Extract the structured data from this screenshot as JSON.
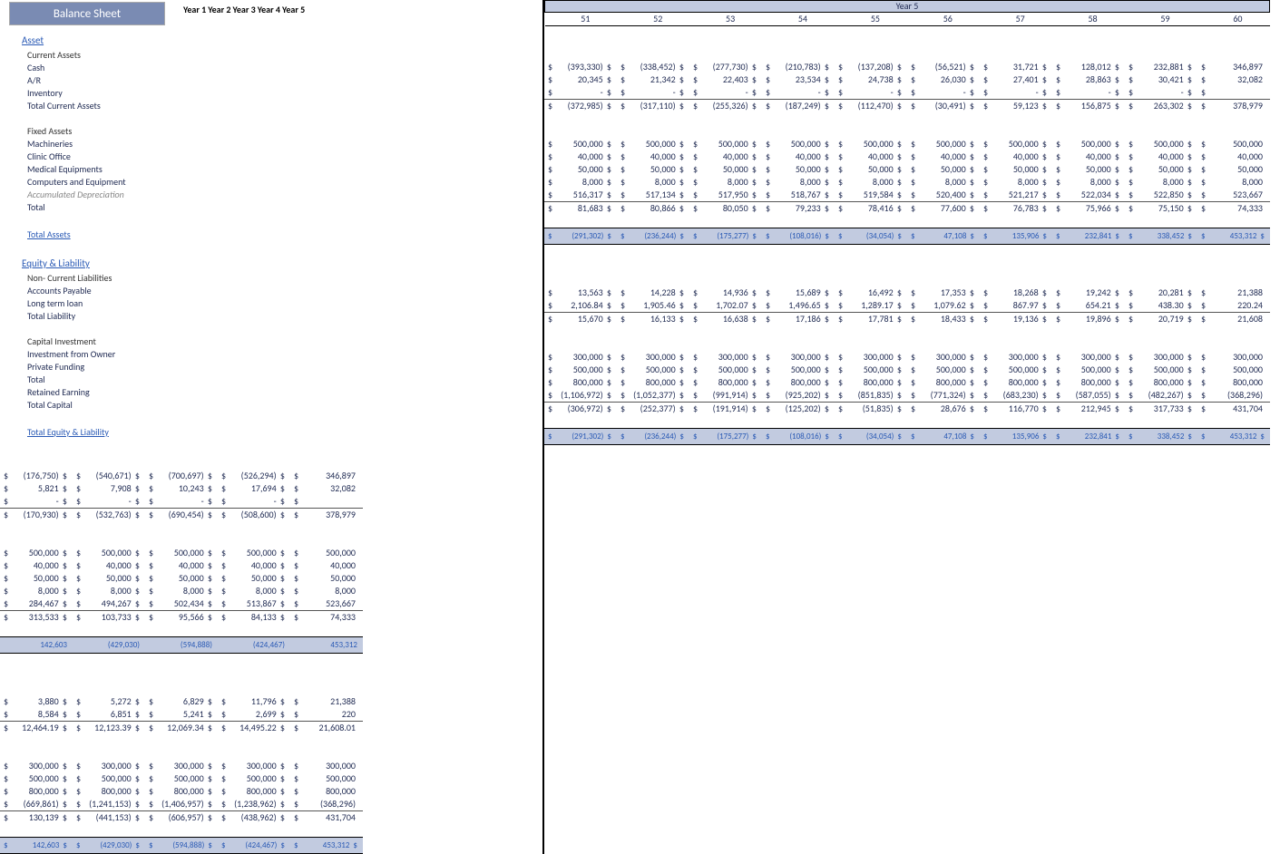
{
  "title": "Balance Sheet",
  "left_years": [
    "Year 1",
    "Year 2",
    "Year 3",
    "Year 4",
    "Year 5"
  ],
  "right_group": "Year 5",
  "right_cols": [
    "51",
    "52",
    "53",
    "54",
    "55",
    "56",
    "57",
    "58",
    "59",
    "60"
  ],
  "sections": [
    {
      "type": "hdr",
      "label": "Asset"
    },
    {
      "type": "sub",
      "label": "Current Assets"
    },
    {
      "label": "Cash",
      "dollar": true,
      "L": [
        "(176,750)",
        "(540,671)",
        "(700,697)",
        "(526,294)",
        "346,897"
      ],
      "R": [
        "(393,330)",
        "(338,452)",
        "(277,730)",
        "(210,783)",
        "(137,208)",
        "(56,521)",
        "31,721",
        "128,012",
        "232,881",
        "346,897"
      ]
    },
    {
      "label": "A/R",
      "dollar": true,
      "L": [
        "5,821",
        "7,908",
        "10,243",
        "17,694",
        "32,082"
      ],
      "R": [
        "20,345",
        "21,342",
        "22,403",
        "23,534",
        "24,738",
        "26,030",
        "27,401",
        "28,863",
        "30,421",
        "32,082"
      ]
    },
    {
      "label": "Inventory",
      "dollar": true,
      "L": [
        "-",
        "-",
        "-",
        "-",
        ""
      ],
      "R": [
        "-",
        "-",
        "-",
        "-",
        "-",
        "-",
        "-",
        "-",
        "-",
        ""
      ],
      "sep": true
    },
    {
      "label": "Total Current Assets",
      "dollar": true,
      "bt": true,
      "L": [
        "(170,930)",
        "(532,763)",
        "(690,454)",
        "(508,600)",
        "378,979"
      ],
      "R": [
        "(372,985)",
        "(317,110)",
        "(255,326)",
        "(187,249)",
        "(112,470)",
        "(30,491)",
        "59,123",
        "156,875",
        "263,302",
        "378,979"
      ]
    },
    {
      "type": "spacer"
    },
    {
      "type": "sub",
      "label": "Fixed Assets"
    },
    {
      "label": "Machineries",
      "dollar": true,
      "L": [
        "500,000",
        "500,000",
        "500,000",
        "500,000",
        "500,000"
      ],
      "R": [
        "500,000",
        "500,000",
        "500,000",
        "500,000",
        "500,000",
        "500,000",
        "500,000",
        "500,000",
        "500,000",
        "500,000"
      ]
    },
    {
      "label": "Clinic Office",
      "dollar": true,
      "L": [
        "40,000",
        "40,000",
        "40,000",
        "40,000",
        "40,000"
      ],
      "R": [
        "40,000",
        "40,000",
        "40,000",
        "40,000",
        "40,000",
        "40,000",
        "40,000",
        "40,000",
        "40,000",
        "40,000"
      ]
    },
    {
      "label": "Medical Equipments",
      "dollar": true,
      "L": [
        "50,000",
        "50,000",
        "50,000",
        "50,000",
        "50,000"
      ],
      "R": [
        "50,000",
        "50,000",
        "50,000",
        "50,000",
        "50,000",
        "50,000",
        "50,000",
        "50,000",
        "50,000",
        "50,000"
      ]
    },
    {
      "label": "Computers and Equipment",
      "dollar": true,
      "L": [
        "8,000",
        "8,000",
        "8,000",
        "8,000",
        "8,000"
      ],
      "R": [
        "8,000",
        "8,000",
        "8,000",
        "8,000",
        "8,000",
        "8,000",
        "8,000",
        "8,000",
        "8,000",
        "8,000"
      ]
    },
    {
      "label": "Accumulated Depreciation",
      "ital": true,
      "dollar": true,
      "L": [
        "284,467",
        "494,267",
        "502,434",
        "513,867",
        "523,667"
      ],
      "R": [
        "516,317",
        "517,134",
        "517,950",
        "518,767",
        "519,584",
        "520,400",
        "521,217",
        "522,034",
        "522,850",
        "523,667"
      ]
    },
    {
      "label": "Total",
      "dollar": true,
      "bt": true,
      "L": [
        "313,533",
        "103,733",
        "95,566",
        "84,133",
        "74,333"
      ],
      "R": [
        "81,683",
        "80,866",
        "80,050",
        "79,233",
        "78,416",
        "77,600",
        "76,783",
        "75,966",
        "75,150",
        "74,333"
      ]
    },
    {
      "type": "spacer"
    },
    {
      "type": "bold",
      "label": "Total Assets",
      "hi": true,
      "L": [
        "142,603",
        "(429,030)",
        "(594,888)",
        "(424,467)",
        "453,312"
      ],
      "Rd": true,
      "R": [
        "(291,302)",
        "(236,244)",
        "(175,277)",
        "(108,016)",
        "(34,054)",
        "47,108",
        "135,906",
        "232,841",
        "338,452",
        "453,312"
      ]
    },
    {
      "type": "spacer"
    },
    {
      "type": "hdr",
      "label": "Equity & Liability"
    },
    {
      "type": "sub",
      "label": "Non- Current Liabilities"
    },
    {
      "label": "Accounts Payable",
      "dollar": true,
      "L": [
        "3,880",
        "5,272",
        "6,829",
        "11,796",
        "21,388"
      ],
      "R": [
        "13,563",
        "14,228",
        "14,936",
        "15,689",
        "16,492",
        "17,353",
        "18,268",
        "19,242",
        "20,281",
        "21,388"
      ]
    },
    {
      "label": "Long term loan",
      "dollar": true,
      "L": [
        "8,584",
        "6,851",
        "5,241",
        "2,699",
        "220"
      ],
      "R": [
        "2,106.84",
        "1,905.46",
        "1,702.07",
        "1,496.65",
        "1,289.17",
        "1,079.62",
        "867.97",
        "654.21",
        "438.30",
        "220.24"
      ]
    },
    {
      "label": "Total Liability",
      "dollar": true,
      "bt": true,
      "L": [
        "12,464.19",
        "12,123.39",
        "12,069.34",
        "14,495.22",
        "21,608.01"
      ],
      "R": [
        "15,670",
        "16,133",
        "16,638",
        "17,186",
        "17,781",
        "18,433",
        "19,136",
        "19,896",
        "20,719",
        "21,608"
      ],
      "sep": true
    },
    {
      "type": "spacer"
    },
    {
      "type": "sub",
      "label": "Capital Investment"
    },
    {
      "label": "Investment from Owner",
      "dollar": true,
      "L": [
        "300,000",
        "300,000",
        "300,000",
        "300,000",
        "300,000"
      ],
      "R": [
        "300,000",
        "300,000",
        "300,000",
        "300,000",
        "300,000",
        "300,000",
        "300,000",
        "300,000",
        "300,000",
        "300,000"
      ]
    },
    {
      "label": "Private Funding",
      "dollar": true,
      "L": [
        "500,000",
        "500,000",
        "500,000",
        "500,000",
        "500,000"
      ],
      "R": [
        "500,000",
        "500,000",
        "500,000",
        "500,000",
        "500,000",
        "500,000",
        "500,000",
        "500,000",
        "500,000",
        "500,000"
      ]
    },
    {
      "label": "Total",
      "dollar": true,
      "L": [
        "800,000",
        "800,000",
        "800,000",
        "800,000",
        "800,000"
      ],
      "R": [
        "800,000",
        "800,000",
        "800,000",
        "800,000",
        "800,000",
        "800,000",
        "800,000",
        "800,000",
        "800,000",
        "800,000"
      ]
    },
    {
      "label": "Retained Earning",
      "dollar": true,
      "L": [
        "(669,861)",
        "(1,241,153)",
        "(1,406,957)",
        "(1,238,962)",
        "(368,296)"
      ],
      "R": [
        "(1,106,972)",
        "(1,052,377)",
        "(991,914)",
        "(925,202)",
        "(851,835)",
        "(771,324)",
        "(683,230)",
        "(587,055)",
        "(482,267)",
        "(368,296)"
      ]
    },
    {
      "label": "Total Capital",
      "dollar": true,
      "bt": true,
      "L": [
        "130,139",
        "(441,153)",
        "(606,957)",
        "(438,962)",
        "431,704"
      ],
      "R": [
        "(306,972)",
        "(252,377)",
        "(191,914)",
        "(125,202)",
        "(51,835)",
        "28,676",
        "116,770",
        "212,945",
        "317,733",
        "431,704"
      ]
    },
    {
      "type": "spacer"
    },
    {
      "type": "bold",
      "label": "Total Equity & Liability",
      "hi": true,
      "Ld": true,
      "L": [
        "142,603",
        "(429,030)",
        "(594,888)",
        "(424,467)",
        "453,312"
      ],
      "Rd": true,
      "R": [
        "(291,302)",
        "(236,244)",
        "(175,277)",
        "(108,016)",
        "(34,054)",
        "47,108",
        "135,906",
        "232,841",
        "338,452",
        "453,312"
      ]
    }
  ],
  "chart_data": {
    "type": "table",
    "title": "Balance Sheet",
    "row_labels": [
      "Cash",
      "A/R",
      "Inventory",
      "Total Current Assets",
      "Machineries",
      "Clinic Office",
      "Medical Equipments",
      "Computers and Equipment",
      "Accumulated Depreciation",
      "Total Fixed Assets",
      "Total Assets",
      "Accounts Payable",
      "Long term loan",
      "Total Liability",
      "Investment from Owner",
      "Private Funding",
      "Total Capital Investment",
      "Retained Earning",
      "Total Capital",
      "Total Equity & Liability"
    ],
    "year_summary_columns": [
      "Year 1",
      "Year 2",
      "Year 3",
      "Year 4",
      "Year 5"
    ],
    "month_columns_year5": [
      51,
      52,
      53,
      54,
      55,
      56,
      57,
      58,
      59,
      60
    ],
    "year_summary": {
      "Cash": [
        -176750,
        -540671,
        -700697,
        -526294,
        346897
      ],
      "A/R": [
        5821,
        7908,
        10243,
        17694,
        32082
      ],
      "Inventory": [
        0,
        0,
        0,
        0,
        0
      ],
      "Total Current Assets": [
        -170930,
        -532763,
        -690454,
        -508600,
        378979
      ],
      "Machineries": [
        500000,
        500000,
        500000,
        500000,
        500000
      ],
      "Clinic Office": [
        40000,
        40000,
        40000,
        40000,
        40000
      ],
      "Medical Equipments": [
        50000,
        50000,
        50000,
        50000,
        50000
      ],
      "Computers and Equipment": [
        8000,
        8000,
        8000,
        8000,
        8000
      ],
      "Accumulated Depreciation": [
        284467,
        494267,
        502434,
        513867,
        523667
      ],
      "Total Fixed Assets": [
        313533,
        103733,
        95566,
        84133,
        74333
      ],
      "Total Assets": [
        142603,
        -429030,
        -594888,
        -424467,
        453312
      ],
      "Accounts Payable": [
        3880,
        5272,
        6829,
        11796,
        21388
      ],
      "Long term loan": [
        8584,
        6851,
        5241,
        2699,
        220
      ],
      "Total Liability": [
        12464.19,
        12123.39,
        12069.34,
        14495.22,
        21608.01
      ],
      "Investment from Owner": [
        300000,
        300000,
        300000,
        300000,
        300000
      ],
      "Private Funding": [
        500000,
        500000,
        500000,
        500000,
        500000
      ],
      "Total Capital Investment": [
        800000,
        800000,
        800000,
        800000,
        800000
      ],
      "Retained Earning": [
        -669861,
        -1241153,
        -1406957,
        -1238962,
        -368296
      ],
      "Total Capital": [
        130139,
        -441153,
        -606957,
        -438962,
        431704
      ],
      "Total Equity & Liability": [
        142603,
        -429030,
        -594888,
        -424467,
        453312
      ]
    },
    "months_year5": {
      "Cash": [
        -393330,
        -338452,
        -277730,
        -210783,
        -137208,
        -56521,
        31721,
        128012,
        232881,
        346897
      ],
      "A/R": [
        20345,
        21342,
        22403,
        23534,
        24738,
        26030,
        27401,
        28863,
        30421,
        32082
      ],
      "Inventory": [
        0,
        0,
        0,
        0,
        0,
        0,
        0,
        0,
        0,
        0
      ],
      "Total Current Assets": [
        -372985,
        -317110,
        -255326,
        -187249,
        -112470,
        -30491,
        59123,
        156875,
        263302,
        378979
      ],
      "Machineries": [
        500000,
        500000,
        500000,
        500000,
        500000,
        500000,
        500000,
        500000,
        500000,
        500000
      ],
      "Clinic Office": [
        40000,
        40000,
        40000,
        40000,
        40000,
        40000,
        40000,
        40000,
        40000,
        40000
      ],
      "Medical Equipments": [
        50000,
        50000,
        50000,
        50000,
        50000,
        50000,
        50000,
        50000,
        50000,
        50000
      ],
      "Computers and Equipment": [
        8000,
        8000,
        8000,
        8000,
        8000,
        8000,
        8000,
        8000,
        8000,
        8000
      ],
      "Accumulated Depreciation": [
        516317,
        517134,
        517950,
        518767,
        519584,
        520400,
        521217,
        522034,
        522850,
        523667
      ],
      "Total Fixed Assets": [
        81683,
        80866,
        80050,
        79233,
        78416,
        77600,
        76783,
        75966,
        75150,
        74333
      ],
      "Total Assets": [
        -291302,
        -236244,
        -175277,
        -108016,
        -34054,
        47108,
        135906,
        232841,
        338452,
        453312
      ],
      "Accounts Payable": [
        13563,
        14228,
        14936,
        15689,
        16492,
        17353,
        18268,
        19242,
        20281,
        21388
      ],
      "Long term loan": [
        2106.84,
        1905.46,
        1702.07,
        1496.65,
        1289.17,
        1079.62,
        867.97,
        654.21,
        438.3,
        220.24
      ],
      "Total Liability": [
        15670,
        16133,
        16638,
        17186,
        17781,
        18433,
        19136,
        19896,
        20719,
        21608
      ],
      "Investment from Owner": [
        300000,
        300000,
        300000,
        300000,
        300000,
        300000,
        300000,
        300000,
        300000,
        300000
      ],
      "Private Funding": [
        500000,
        500000,
        500000,
        500000,
        500000,
        500000,
        500000,
        500000,
        500000,
        500000
      ],
      "Total Capital Investment": [
        800000,
        800000,
        800000,
        800000,
        800000,
        800000,
        800000,
        800000,
        800000,
        800000
      ],
      "Retained Earning": [
        -1106972,
        -1052377,
        -991914,
        -925202,
        -851835,
        -771324,
        -683230,
        -587055,
        -482267,
        -368296
      ],
      "Total Capital": [
        -306972,
        -252377,
        -191914,
        -125202,
        -51835,
        28676,
        116770,
        212945,
        317733,
        431704
      ],
      "Total Equity & Liability": [
        -291302,
        -236244,
        -175277,
        -108016,
        -34054,
        47108,
        135906,
        232841,
        338452,
        453312
      ]
    }
  }
}
